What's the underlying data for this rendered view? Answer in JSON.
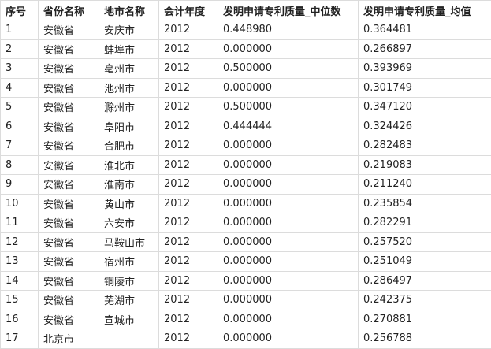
{
  "table": {
    "columns": [
      "序号",
      "省份名称",
      "地市名称",
      "会计年度",
      "发明申请专利质量_中位数",
      "发明申请专利质量_均值"
    ],
    "rows": [
      [
        "1",
        "安徽省",
        "安庆市",
        "2012",
        "0.448980",
        "0.364481"
      ],
      [
        "2",
        "安徽省",
        "蚌埠市",
        "2012",
        "0.000000",
        "0.266897"
      ],
      [
        "3",
        "安徽省",
        "亳州市",
        "2012",
        "0.500000",
        "0.393969"
      ],
      [
        "4",
        "安徽省",
        "池州市",
        "2012",
        "0.000000",
        "0.301749"
      ],
      [
        "5",
        "安徽省",
        "滁州市",
        "2012",
        "0.500000",
        "0.347120"
      ],
      [
        "6",
        "安徽省",
        "阜阳市",
        "2012",
        "0.444444",
        "0.324426"
      ],
      [
        "7",
        "安徽省",
        "合肥市",
        "2012",
        "0.000000",
        "0.282483"
      ],
      [
        "8",
        "安徽省",
        "淮北市",
        "2012",
        "0.000000",
        "0.219083"
      ],
      [
        "9",
        "安徽省",
        "淮南市",
        "2012",
        "0.000000",
        "0.211240"
      ],
      [
        "10",
        "安徽省",
        "黄山市",
        "2012",
        "0.000000",
        "0.235854"
      ],
      [
        "11",
        "安徽省",
        "六安市",
        "2012",
        "0.000000",
        "0.282291"
      ],
      [
        "12",
        "安徽省",
        "马鞍山市",
        "2012",
        "0.000000",
        "0.257520"
      ],
      [
        "13",
        "安徽省",
        "宿州市",
        "2012",
        "0.000000",
        "0.251049"
      ],
      [
        "14",
        "安徽省",
        "铜陵市",
        "2012",
        "0.000000",
        "0.286497"
      ],
      [
        "15",
        "安徽省",
        "芜湖市",
        "2012",
        "0.000000",
        "0.242375"
      ],
      [
        "16",
        "安徽省",
        "宣城市",
        "2012",
        "0.000000",
        "0.270881"
      ],
      [
        "17",
        "北京市",
        "",
        "2012",
        "0.000000",
        "0.256788"
      ]
    ]
  }
}
